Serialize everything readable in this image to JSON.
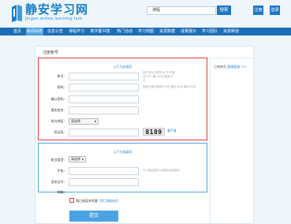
{
  "header": {
    "logo_cn": "静安学习网",
    "logo_en": "Jingan online learning hub",
    "search_value": "课程",
    "search_button": "搜索",
    "register_button": "注册",
    "login_button": "登录"
  },
  "nav": {
    "items": [
      "首页",
      "新闻动态",
      "信息公告",
      "课程学习",
      "数字图书馆",
      "热门活动",
      "学习地图",
      "资源数据",
      "成果展示",
      "学习团队",
      "资源频道"
    ],
    "active_index": 1
  },
  "panel": {
    "title": "注册帐号",
    "login_hint_prefix": "已有帐号,",
    "login_hint_link": "直接登录 >>"
  },
  "section_required": {
    "caption": "以下为必填项",
    "fields": [
      {
        "label": "帐号:",
        "note": "用户名以字母开头,不可超过15个,最少3位,最多20位"
      },
      {
        "label": "密码:",
        "note": "密码长度不能低于6位,最长18位,最长20位"
      },
      {
        "label": "确认密码:",
        "note": ""
      },
      {
        "label": "真实姓名:",
        "note": ""
      },
      {
        "label": "所在地区:",
        "note": ""
      },
      {
        "label": "验证码:",
        "note": ""
      }
    ],
    "region_select": "请选择",
    "captcha_value": "8189",
    "captcha_refresh": "看不清"
  },
  "section_optional": {
    "caption": "以下为选填项",
    "fields": [
      {
        "label": "职业类型:",
        "note": ""
      },
      {
        "label": "手机:",
        "note": "为了保证您可以顺利找回密码"
      },
      {
        "label": "身份证号:",
        "note": ""
      },
      {
        "label": "邮箱:",
        "note": ""
      }
    ],
    "job_select": "请选择"
  },
  "agreement": {
    "prefix": "我已阅读并同意",
    "link": "《学习网协议》"
  },
  "submit_label": "提交"
}
